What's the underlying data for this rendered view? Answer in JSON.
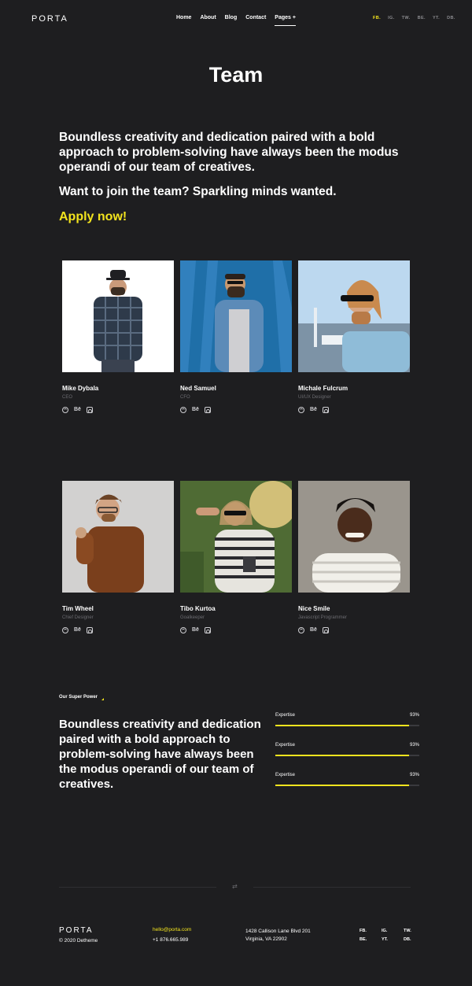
{
  "header": {
    "logo": "PORTA",
    "nav": [
      "Home",
      "About",
      "Blog",
      "Contact",
      "Pages"
    ],
    "nav_plus": "+",
    "social": [
      "FB.",
      "IG.",
      "TW.",
      "BE.",
      "YT.",
      "DB."
    ]
  },
  "hero": {
    "title": "Team",
    "intro": "Boundless creativity and dedication paired with a bold approach to problem-solving have always been the modus operandi of our team of creatives.",
    "join": "Want to join the team? Sparkling minds wanted.",
    "apply": "Apply now!"
  },
  "team": [
    {
      "name": "Mike Dybala",
      "role": "CEO"
    },
    {
      "name": "Ned Samuel",
      "role": "CFO"
    },
    {
      "name": "Michale Fulcrum",
      "role": "UI/UX Designer"
    },
    {
      "name": "Tim Wheel",
      "role": "Chief Designer"
    },
    {
      "name": "Tibo Kurtoa",
      "role": "Goalkeeper"
    },
    {
      "name": "Nice Smile",
      "role": "Javascript Programmer"
    }
  ],
  "team_icon_be": "Bē",
  "superpower": {
    "label": "Our Super Power",
    "text": "Boundless creativity and dedication paired with a bold approach to problem-solving have always been the modus operandi of our team of creatives.",
    "bars": [
      {
        "label": "Expertise",
        "value": "93%",
        "fraction": 0.93
      },
      {
        "label": "Expertise",
        "value": "93%",
        "fraction": 0.93
      },
      {
        "label": "Expertise",
        "value": "93%",
        "fraction": 0.93
      }
    ]
  },
  "footer": {
    "divider_icon": "⇄",
    "logo": "PORTA",
    "copyright": "© 2020 Detheme",
    "email": "hello@porta.com",
    "phone": "+1 876.665.989",
    "address_line1": "1428 Callison Lane Blvd 201",
    "address_line2": "Virginia, VA 22902",
    "social": [
      "FB.",
      "IG.",
      "TW.",
      "BE.",
      "YT.",
      "DB."
    ]
  },
  "colors": {
    "background": "#1e1e20",
    "accent": "#f3e41e"
  }
}
